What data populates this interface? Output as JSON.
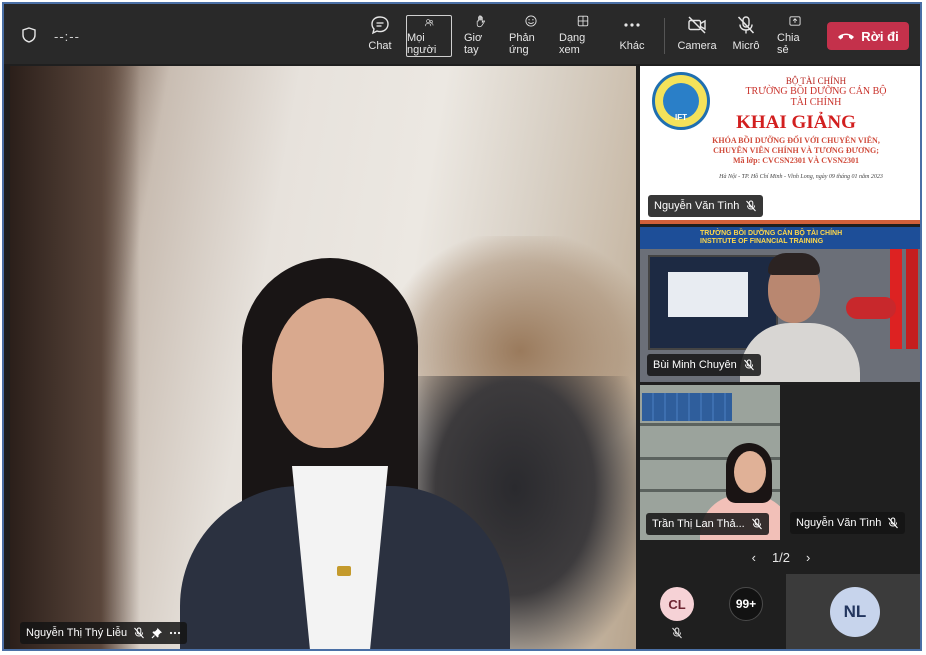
{
  "topbar": {
    "timer": "--:--",
    "buttons": {
      "chat": "Chat",
      "people": "Mọi người",
      "raise_hand": "Giơ tay",
      "reactions": "Phản ứng",
      "view": "Dạng xem",
      "more": "Khác",
      "camera": "Camera",
      "mic": "Micrô",
      "share": "Chia sẻ"
    },
    "leave_label": "Rời đi"
  },
  "main_video": {
    "participant_name": "Nguyễn Thị Thý Liễu"
  },
  "tiles": [
    {
      "participant_name": "Nguyễn Văn Tình",
      "slide": {
        "line1": "BỘ TÀI CHÍNH",
        "line2": "TRƯỜNG BỒI DƯỠNG CÁN BỘ",
        "line3": "TÀI CHÍNH",
        "headline": "KHAI GIẢNG",
        "sub1": "KHÓA BỒI DƯỠNG ĐỐI VỚI CHUYÊN VIÊN,",
        "sub2": "CHUYÊN VIÊN CHÍNH VÀ TƯƠNG ĐƯƠNG;",
        "sub3": "Mã lớp: CVCSN2301 VÀ CVSN2301",
        "footer": "Hà Nội - TP. Hồ Chí Minh - Vĩnh Long, ngày 09 tháng 01 năm 2023",
        "logo_text": "IFT"
      }
    },
    {
      "participant_name": "Bùi Minh Chuyên",
      "banner_line1": "TRƯỜNG BỒI DƯỠNG CÁN BỘ TÀI CHÍNH",
      "banner_line2": "INSTITUTE OF FINANCIAL TRAINING"
    },
    {
      "participant_name": "Trần Thị Lan Thả..."
    },
    {
      "participant_name": "Nguyễn Văn Tình"
    }
  ],
  "pager": {
    "label": "1/2"
  },
  "avatars": {
    "cl": "CL",
    "overflow": "99+",
    "nl": "NL"
  },
  "colors": {
    "leave_button": "#c4314b",
    "topbar_bg": "#292929",
    "stage_bg": "#1f1f1f",
    "avatar_nl_bg": "#c7d4ec",
    "avatar_cl_bg": "#f6d2d6"
  },
  "icons": {
    "chat": "chat-icon",
    "people": "people-icon",
    "raise_hand": "hand-icon",
    "reactions": "smiley-icon",
    "view": "grid-icon",
    "more": "ellipsis-icon",
    "camera": "camera-off-icon",
    "mic": "mic-off-icon",
    "share": "share-icon",
    "leave": "phone-hangup-icon"
  }
}
